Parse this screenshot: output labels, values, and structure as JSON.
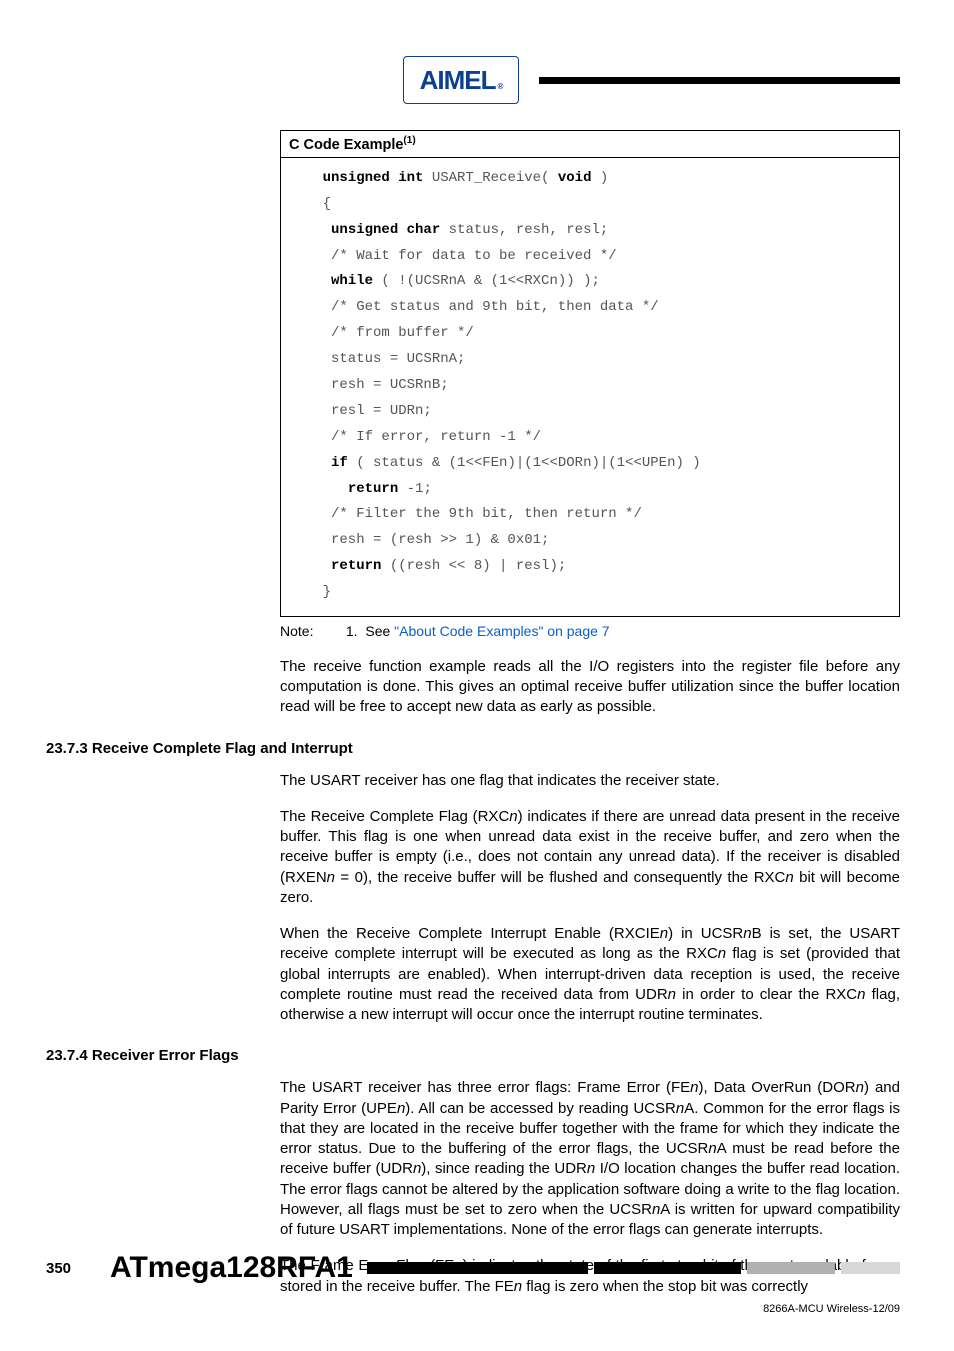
{
  "logo": {
    "text": "AIMEL",
    "reg": "®"
  },
  "code_box": {
    "title_prefix": "C Code Example",
    "title_sup": "(1)",
    "lines": [
      {
        "indent": "    ",
        "segs": [
          {
            "t": "unsigned int ",
            "kw": true
          },
          {
            "t": "USART_Receive( "
          },
          {
            "t": "void",
            "kw": true
          },
          {
            "t": " )"
          }
        ]
      },
      {
        "indent": "    ",
        "segs": [
          {
            "t": "{"
          }
        ]
      },
      {
        "indent": "     ",
        "segs": [
          {
            "t": "unsigned char ",
            "kw": true
          },
          {
            "t": "status, resh, resl;"
          }
        ]
      },
      {
        "indent": "     ",
        "segs": [
          {
            "t": "/* Wait for data to be received */"
          }
        ]
      },
      {
        "indent": "     ",
        "segs": [
          {
            "t": "while",
            "kw": true
          },
          {
            "t": " ( !(UCSRnA & (1<<RXCn)) );"
          }
        ]
      },
      {
        "indent": "     ",
        "segs": [
          {
            "t": "/* Get status and 9th bit, then data */"
          }
        ]
      },
      {
        "indent": "     ",
        "segs": [
          {
            "t": "/* from buffer */"
          }
        ]
      },
      {
        "indent": "     ",
        "segs": [
          {
            "t": "status = UCSRnA;"
          }
        ]
      },
      {
        "indent": "     ",
        "segs": [
          {
            "t": "resh = UCSRnB;"
          }
        ]
      },
      {
        "indent": "     ",
        "segs": [
          {
            "t": "resl = UDRn;"
          }
        ]
      },
      {
        "indent": "     ",
        "segs": [
          {
            "t": "/* If error, return -1 */"
          }
        ]
      },
      {
        "indent": "     ",
        "segs": [
          {
            "t": "if",
            "kw": true
          },
          {
            "t": " ( status & (1<<FEn)|(1<<DORn)|(1<<UPEn) )"
          }
        ]
      },
      {
        "indent": "       ",
        "segs": [
          {
            "t": "return",
            "kw": true
          },
          {
            "t": " -1;"
          }
        ]
      },
      {
        "indent": "     ",
        "segs": [
          {
            "t": "/* Filter the 9th bit, then return */"
          }
        ]
      },
      {
        "indent": "     ",
        "segs": [
          {
            "t": "resh = (resh >> 1) & 0x01;"
          }
        ]
      },
      {
        "indent": "     ",
        "segs": [
          {
            "t": "return",
            "kw": true
          },
          {
            "t": " ((resh << 8) | resl);"
          }
        ]
      },
      {
        "indent": "    ",
        "segs": [
          {
            "t": "}"
          }
        ]
      }
    ]
  },
  "note": {
    "label": "Note:",
    "num": "1.",
    "pre": "See ",
    "link": "\"About Code Examples\" on page 7"
  },
  "para1": "The receive function example reads all the I/O registers into the register file before any computation is done. This gives an optimal receive buffer utilization since the buffer location read will be free to accept new data as early as possible.",
  "section1": {
    "heading": "23.7.3 Receive Complete Flag and Interrupt",
    "p1": "The USART receiver has one flag that indicates the receiver state.",
    "p2_parts": [
      {
        "t": "The Receive Complete Flag (RXC"
      },
      {
        "t": "n",
        "i": true
      },
      {
        "t": ") indicates if there are unread data present in the receive buffer. This flag is one when unread data exist in the receive buffer, and zero when the receive buffer is empty (i.e., does not contain any unread data). If the receiver is disabled (RXEN"
      },
      {
        "t": "n",
        "i": true
      },
      {
        "t": " = 0), the receive buffer will be flushed and consequently the RXC"
      },
      {
        "t": "n",
        "i": true
      },
      {
        "t": " bit will become zero."
      }
    ],
    "p3_parts": [
      {
        "t": "When the Receive Complete Interrupt Enable (RXCIE"
      },
      {
        "t": "n",
        "i": true
      },
      {
        "t": ") in UCSR"
      },
      {
        "t": "n",
        "i": true
      },
      {
        "t": "B is set, the USART receive complete interrupt will be executed as long as the RXC"
      },
      {
        "t": "n",
        "i": true
      },
      {
        "t": " flag is set (provided that global interrupts are enabled). When interrupt-driven data reception is used, the receive complete routine must read the received data from UDR"
      },
      {
        "t": "n",
        "i": true
      },
      {
        "t": " in order to clear the RXC"
      },
      {
        "t": "n",
        "i": true
      },
      {
        "t": " flag, otherwise a new interrupt will occur once the interrupt routine terminates."
      }
    ]
  },
  "section2": {
    "heading": "23.7.4 Receiver Error Flags",
    "p1_parts": [
      {
        "t": "The USART receiver has three error flags: Frame Error (FE"
      },
      {
        "t": "n",
        "i": true
      },
      {
        "t": "), Data OverRun (DOR"
      },
      {
        "t": "n",
        "i": true
      },
      {
        "t": ") and Parity Error (UPE"
      },
      {
        "t": "n",
        "i": true
      },
      {
        "t": "). All can be accessed by reading UCSR"
      },
      {
        "t": "n",
        "i": true
      },
      {
        "t": "A. Common for the error flags is that they are located in the receive buffer together with the frame for which they indicate the error status. Due to the buffering of the error flags, the UCSR"
      },
      {
        "t": "n",
        "i": true
      },
      {
        "t": "A must be read before the receive buffer (UDR"
      },
      {
        "t": "n",
        "i": true
      },
      {
        "t": "), since reading the UDR"
      },
      {
        "t": "n",
        "i": true
      },
      {
        "t": " I/O location changes the buffer read location. The error flags cannot be altered by the application software doing a write to the flag location. However, all flags must be set to zero when the UCSR"
      },
      {
        "t": "n",
        "i": true
      },
      {
        "t": "A is written for upward compatibility of future USART implementations. None of the error flags can generate interrupts."
      }
    ],
    "p2_parts": [
      {
        "t": "The Frame Error Flag (FE"
      },
      {
        "t": "n",
        "i": true
      },
      {
        "t": ") indicates the state of the first stop bit of the next readable frame stored in the receive buffer. The FE"
      },
      {
        "t": "n",
        "i": true
      },
      {
        "t": " flag is zero when the stop bit was correctly"
      }
    ]
  },
  "footer": {
    "page": "350",
    "product": "ATmega128RFA1",
    "doccode": "8266A-MCU Wireless-12/09"
  }
}
